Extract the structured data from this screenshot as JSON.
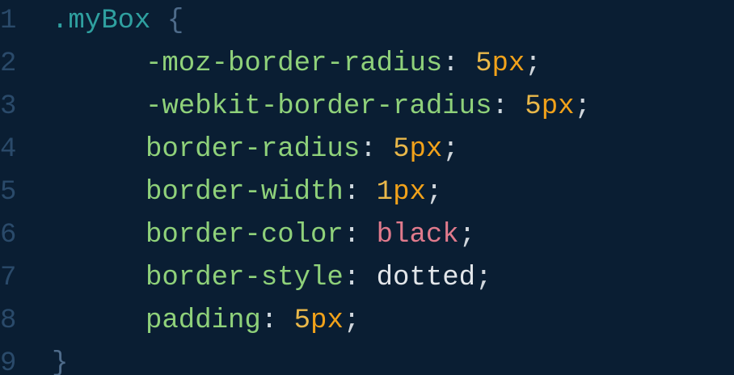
{
  "editor": {
    "lines": [
      {
        "number": "1",
        "tokens": [
          {
            "t": ".myBox",
            "c": "selector"
          },
          {
            "t": " ",
            "c": "punct"
          },
          {
            "t": "{",
            "c": "brace"
          }
        ]
      },
      {
        "number": "2",
        "indent": true,
        "tokens": [
          {
            "t": "-moz-border-radius",
            "c": "prop"
          },
          {
            "t": ": ",
            "c": "punct"
          },
          {
            "t": "5",
            "c": "num"
          },
          {
            "t": "px",
            "c": "unit"
          },
          {
            "t": ";",
            "c": "semi"
          }
        ]
      },
      {
        "number": "3",
        "indent": true,
        "tokens": [
          {
            "t": "-webkit-border-radius",
            "c": "prop"
          },
          {
            "t": ": ",
            "c": "punct"
          },
          {
            "t": "5",
            "c": "num"
          },
          {
            "t": "px",
            "c": "unit"
          },
          {
            "t": ";",
            "c": "semi"
          }
        ]
      },
      {
        "number": "4",
        "indent": true,
        "tokens": [
          {
            "t": "border-radius",
            "c": "prop"
          },
          {
            "t": ": ",
            "c": "punct"
          },
          {
            "t": "5",
            "c": "num"
          },
          {
            "t": "px",
            "c": "unit"
          },
          {
            "t": ";",
            "c": "semi"
          }
        ]
      },
      {
        "number": "5",
        "indent": true,
        "tokens": [
          {
            "t": "border-width",
            "c": "prop"
          },
          {
            "t": ": ",
            "c": "punct"
          },
          {
            "t": "1",
            "c": "num"
          },
          {
            "t": "px",
            "c": "unit"
          },
          {
            "t": ";",
            "c": "semi"
          }
        ]
      },
      {
        "number": "6",
        "indent": true,
        "tokens": [
          {
            "t": "border-color",
            "c": "prop"
          },
          {
            "t": ": ",
            "c": "punct"
          },
          {
            "t": "black",
            "c": "color"
          },
          {
            "t": ";",
            "c": "semi"
          }
        ]
      },
      {
        "number": "7",
        "indent": true,
        "tokens": [
          {
            "t": "border-style",
            "c": "prop"
          },
          {
            "t": ": ",
            "c": "punct"
          },
          {
            "t": "dotted",
            "c": "ident"
          },
          {
            "t": ";",
            "c": "semi"
          }
        ]
      },
      {
        "number": "8",
        "indent": true,
        "tokens": [
          {
            "t": "padding",
            "c": "prop"
          },
          {
            "t": ": ",
            "c": "punct"
          },
          {
            "t": "5",
            "c": "num"
          },
          {
            "t": "px",
            "c": "unit"
          },
          {
            "t": ";",
            "c": "semi"
          }
        ]
      },
      {
        "number": "9",
        "tokens": [
          {
            "t": "}",
            "c": "brace"
          }
        ]
      }
    ]
  },
  "colors": {
    "background": "#0a1e33",
    "line_number": "#2a4a6a",
    "selector": "#2fa0a0",
    "property": "#8fd17a",
    "number": "#e9b84a",
    "unit": "#f2a21a",
    "color_keyword": "#e07a8c",
    "identifier": "#e2e6ea"
  }
}
